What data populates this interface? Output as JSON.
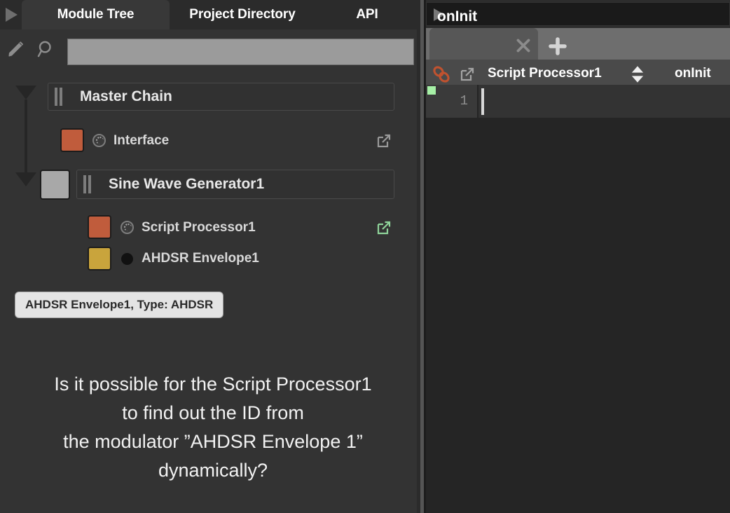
{
  "left_panel": {
    "play_icon": "play-triangle-icon",
    "tabs": [
      {
        "label": "Module Tree",
        "active": true
      },
      {
        "label": "Project Directory",
        "active": false
      },
      {
        "label": "API",
        "active": false
      }
    ],
    "toolbar": {
      "pencil_icon": "pencil-icon",
      "search_icon": "search-icon",
      "search_value": "",
      "search_placeholder": ""
    },
    "tree": {
      "nodes": [
        {
          "id": "master-chain",
          "kind": "chain",
          "label": "Master Chain",
          "expanded": true,
          "grip_icon": "drag-grip-icon"
        },
        {
          "id": "interface",
          "kind": "module",
          "label": "Interface",
          "color": "#c05c3c",
          "badge_icon": "dial-knob-icon",
          "ext_icon": "external-link-icon",
          "ext_color": "#9a9a9a"
        },
        {
          "id": "sine-wave-generator1",
          "kind": "chain",
          "label": "Sine Wave Generator1",
          "expanded": true,
          "color": "#a8a8a8",
          "grip_icon": "drag-grip-icon"
        },
        {
          "id": "script-processor1",
          "kind": "module",
          "label": "Script Processor1",
          "color": "#c05c3c",
          "badge_icon": "dial-knob-icon",
          "ext_icon": "external-link-icon",
          "ext_color": "#8fd49a"
        },
        {
          "id": "ahdsr-envelope1",
          "kind": "module",
          "label": "AHDSR Envelope1",
          "color": "#c9a43c",
          "badge_icon": "solid-dot-icon"
        }
      ]
    },
    "tooltip": "AHDSR Envelope1, Type: AHDSR",
    "annotation": "Is it possible for the Script Processor1\nto find out the ID from\nthe modulator ”AHDSR Envelope 1”\ndynamically?"
  },
  "right_panel": {
    "play_icon": "play-triangle-icon",
    "tab": {
      "label": "onInit",
      "close_icon": "close-x-icon",
      "add_icon": "plus-icon"
    },
    "pathbar": {
      "link_icon": "chain-link-icon",
      "link_color": "#c0522f",
      "popout_icon": "external-link-icon",
      "module_name": "Script Processor1",
      "spinner_icon": "up-down-arrows-icon",
      "callback_name": "onInit"
    },
    "editor": {
      "breakpoint_icon": "breakpoint-marker",
      "line_numbers": [
        "1"
      ],
      "lines": [
        ""
      ],
      "caret_line": 1
    }
  },
  "colors": {
    "app_bg": "#2d2d2d",
    "panel_bg": "#333333",
    "tab_active": "#383838",
    "accent_orange": "#c05c3c",
    "accent_yellow": "#c9a43c",
    "accent_green": "#8fd49a",
    "editor_bg": "#252525"
  }
}
